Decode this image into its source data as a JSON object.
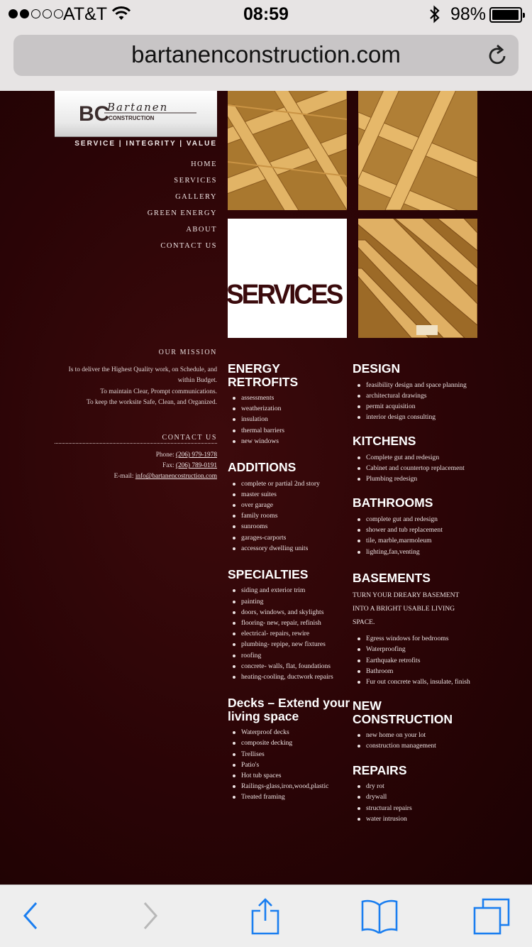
{
  "status_bar": {
    "carrier": "AT&T",
    "time": "08:59",
    "battery_percent": "98%",
    "battery_level": 0.98,
    "signal_bars_filled": 2,
    "signal_bars_total": 5
  },
  "browser": {
    "url": "bartanenconstruction.com"
  },
  "site": {
    "logo_text": "BC",
    "logo_script": "Bartanen",
    "logo_sub": "CONSTRUCTION",
    "tagline": "SERVICE | INTEGRITY | VALUE",
    "nav": [
      "HOME",
      "SERVICES",
      "GALLERY",
      "GREEN ENERGY",
      "ABOUT",
      "CONTACT US"
    ],
    "hero_word": "SERVICES",
    "mission": {
      "heading": "OUR MISSION",
      "lines": [
        "Is to deliver the Highest Quality work, on Schedule, and",
        "within Budget.",
        "To maintain Clear, Prompt communications.",
        "To keep the worksite Safe, Clean, and Organized."
      ]
    },
    "contact": {
      "heading": "CONTACT US",
      "phone_label": "Phone:",
      "phone": "(206) 979-1978",
      "fax_label": "Fax:",
      "fax": "(206) 789-0191",
      "email_label": "E-mail:",
      "email": "info@bartanencostruction.com"
    }
  },
  "sections_left": [
    {
      "title": "ENERGY RETROFITS",
      "items": [
        "assessments",
        "weatherization",
        "insulation",
        "thermal barriers",
        "new windows"
      ]
    },
    {
      "title": "ADDITIONS",
      "items": [
        "complete or partial 2nd story",
        "master suites",
        "over garage",
        "family rooms",
        "sunrooms",
        "garages-carports",
        "accessory dwelling units"
      ]
    },
    {
      "title": "SPECIALTIES",
      "items": [
        "siding and exterior trim",
        "painting",
        "doors, windows, and skylights",
        "flooring- new, repair, refinish",
        "electrical- repairs, rewire",
        "plumbing- repipe, new fixtures",
        "roofing",
        "concrete- walls, flat, foundations",
        "heating-cooling, ductwork repairs"
      ]
    },
    {
      "title": "Decks – Extend your living space",
      "items": [
        "Waterproof decks",
        "composite decking",
        "Trellises",
        "Patio's",
        "Hot tub spaces",
        "Railings-glass,iron,wood,plastic",
        "Treated framing"
      ]
    }
  ],
  "sections_right": [
    {
      "title": "DESIGN",
      "items": [
        "feasibility design and space planning",
        "architectural drawings",
        "permit acquisition",
        "interior design consulting"
      ]
    },
    {
      "title": "KITCHENS",
      "items": [
        "Complete gut and redesign",
        "Cabinet and countertop replacement",
        "Plumbing redesign"
      ]
    },
    {
      "title": "BATHROOMS",
      "items": [
        "complete gut and redesign",
        "shower and tub replacement",
        "tile, marble,marmoleum",
        "lighting,fan,venting"
      ]
    },
    {
      "title": "BASEMENTS",
      "intro": "TURN YOUR DREARY BASEMENT INTO A BRIGHT USABLE LIVING SPACE.",
      "items": [
        "Egress windows for bedrooms",
        "Waterproofing",
        "Earthquake retrofits",
        "Bathroom",
        "Fur out concrete walls, insulate, finish"
      ]
    },
    {
      "title": "NEW CONSTRUCTION",
      "items": [
        "new home on your lot",
        "construction management"
      ]
    },
    {
      "title": "REPAIRS",
      "items": [
        "dry rot",
        "drywall",
        "structural repairs",
        "water intrusion"
      ]
    }
  ],
  "colors": {
    "page_bg": "#2a0406",
    "accent": "#3a0a0c",
    "ios_blue": "#1a7ef0",
    "text": "#f3ecec"
  },
  "toolbar_icons": [
    "back-icon",
    "forward-icon",
    "share-icon",
    "bookmarks-icon",
    "tabs-icon"
  ]
}
